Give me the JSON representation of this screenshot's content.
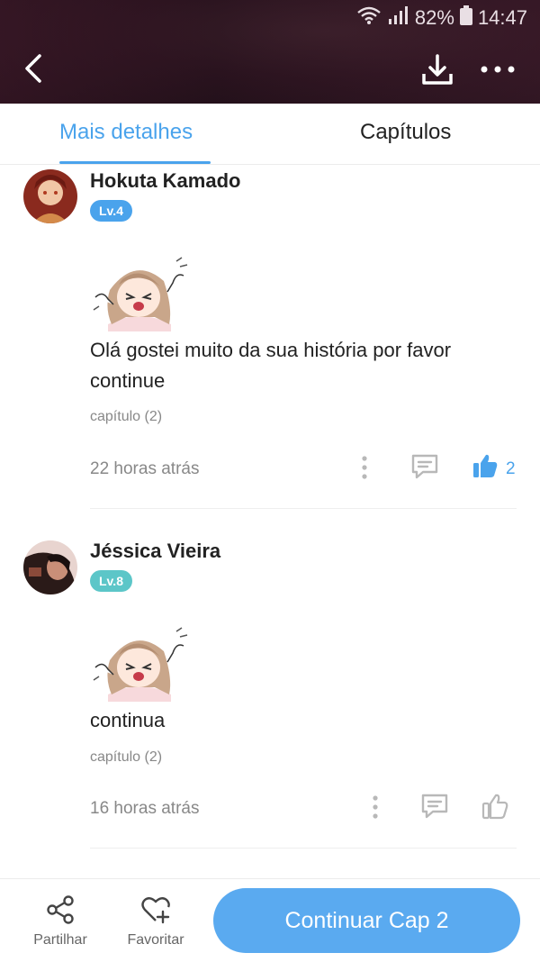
{
  "status_bar": {
    "battery": "82%",
    "time": "14:47"
  },
  "header": {
    "back_icon": "chevron-left-icon",
    "download_icon": "download-icon",
    "more_icon": "more-dots-icon"
  },
  "tabs": [
    {
      "label": "Mais detalhes",
      "active": true
    },
    {
      "label": "Capítulos",
      "active": false
    }
  ],
  "comments": [
    {
      "author": "Hokuta Kamado",
      "level": "Lv.4",
      "level_color": "#4aa3ec",
      "text": "Olá gostei muito da sua história por favor continue",
      "chapter": "capítulo (2)",
      "time": "22 horas atrás",
      "likes": "2",
      "liked": true
    },
    {
      "author": "Jéssica Vieira",
      "level": "Lv.8",
      "level_color": "#5cc6c8",
      "text": "continua",
      "chapter": "capítulo (2)",
      "time": "16 horas atrás",
      "likes": "",
      "liked": false
    }
  ],
  "bottom_bar": {
    "share_label": "Partilhar",
    "favorite_label": "Favoritar",
    "continue_label": "Continuar Cap 2"
  },
  "colors": {
    "accent": "#4aa3ec",
    "header_bg": "#2c1420"
  }
}
